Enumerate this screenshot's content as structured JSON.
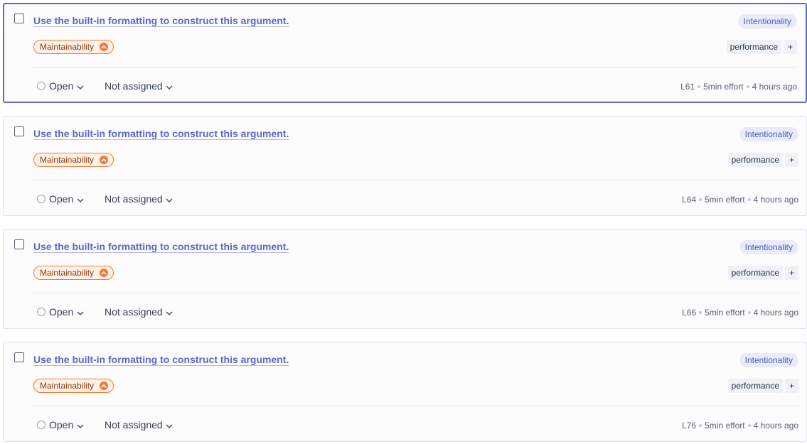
{
  "issues": [
    {
      "title": "Use the built-in formatting to construct this argument.",
      "clean_code_attribute": "Intentionality",
      "quality": "Maintainability",
      "tag": "performance",
      "add_tag": "+",
      "status": "Open",
      "assignee": "Not assigned",
      "line": "L61",
      "effort": "5min effort",
      "age": "4 hours ago",
      "selected": true
    },
    {
      "title": "Use the built-in formatting to construct this argument.",
      "clean_code_attribute": "Intentionality",
      "quality": "Maintainability",
      "tag": "performance",
      "add_tag": "+",
      "status": "Open",
      "assignee": "Not assigned",
      "line": "L64",
      "effort": "5min effort",
      "age": "4 hours ago",
      "selected": false
    },
    {
      "title": "Use the built-in formatting to construct this argument.",
      "clean_code_attribute": "Intentionality",
      "quality": "Maintainability",
      "tag": "performance",
      "add_tag": "+",
      "status": "Open",
      "assignee": "Not assigned",
      "line": "L66",
      "effort": "5min effort",
      "age": "4 hours ago",
      "selected": false
    },
    {
      "title": "Use the built-in formatting to construct this argument.",
      "clean_code_attribute": "Intentionality",
      "quality": "Maintainability",
      "tag": "performance",
      "add_tag": "+",
      "status": "Open",
      "assignee": "Not assigned",
      "line": "L76",
      "effort": "5min effort",
      "age": "4 hours ago",
      "selected": false
    }
  ],
  "colors": {
    "accent": "#5d6cc9",
    "link": "#5a67c8",
    "maintainability": "#f07c3a",
    "intentionality_bg": "#e8ebfa"
  },
  "icons": {
    "severity": "chevron-up-icon",
    "dropdown": "chevron-down-icon",
    "status": "open-status-circle-icon"
  }
}
